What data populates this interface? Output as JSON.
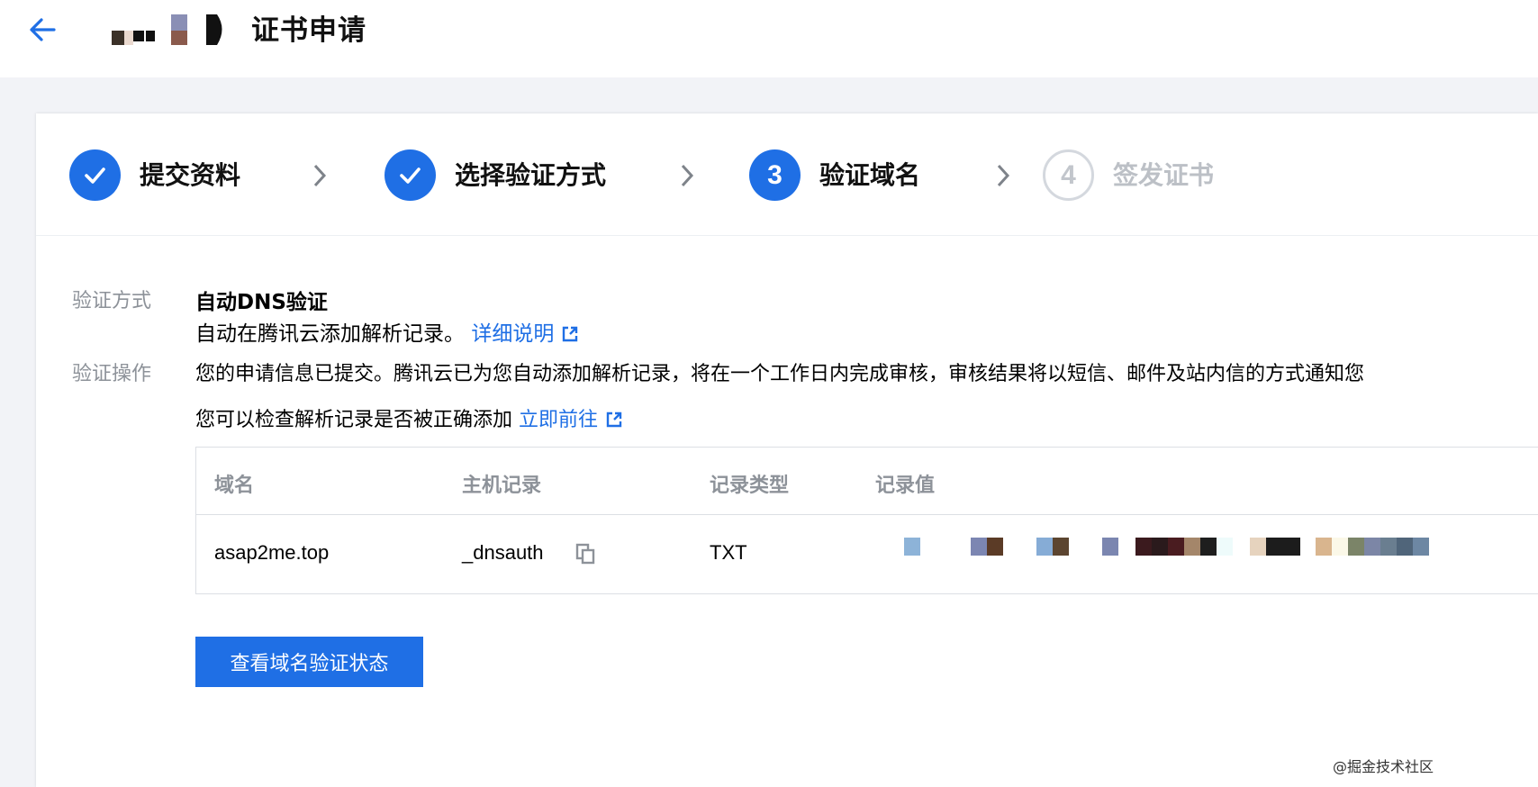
{
  "header": {
    "title": "证书申请",
    "back_icon": "arrow-left-icon"
  },
  "colors": {
    "primary": "#1f6fe5",
    "muted": "#8d9299",
    "pending": "#bcc0c6"
  },
  "steps": [
    {
      "label": "提交资料",
      "state": "done",
      "icon": "check-icon"
    },
    {
      "label": "选择验证方式",
      "state": "done",
      "icon": "check-icon"
    },
    {
      "label": "验证域名",
      "state": "active",
      "number": "3"
    },
    {
      "label": "签发证书",
      "state": "pending",
      "number": "4"
    }
  ],
  "verify_method": {
    "label": "验证方式",
    "title": "自动DNS验证",
    "description": "自动在腾讯云添加解析记录。",
    "link": "详细说明"
  },
  "verify_action": {
    "label": "验证操作",
    "message": "您的申请信息已提交。腾讯云已为您自动添加解析记录，将在一个工作日内完成审核，审核结果将以短信、邮件及站内信的方式通知您",
    "check_text": "您可以检查解析记录是否被正确添加",
    "check_link": "立即前往"
  },
  "table": {
    "headers": [
      "域名",
      "主机记录",
      "记录类型",
      "记录值"
    ],
    "rows": [
      {
        "domain": "asap2me.top",
        "host": "_dnsauth",
        "type": "TXT"
      }
    ]
  },
  "button": {
    "label": "查看域名验证状态"
  },
  "watermark": "@掘金技术社区"
}
